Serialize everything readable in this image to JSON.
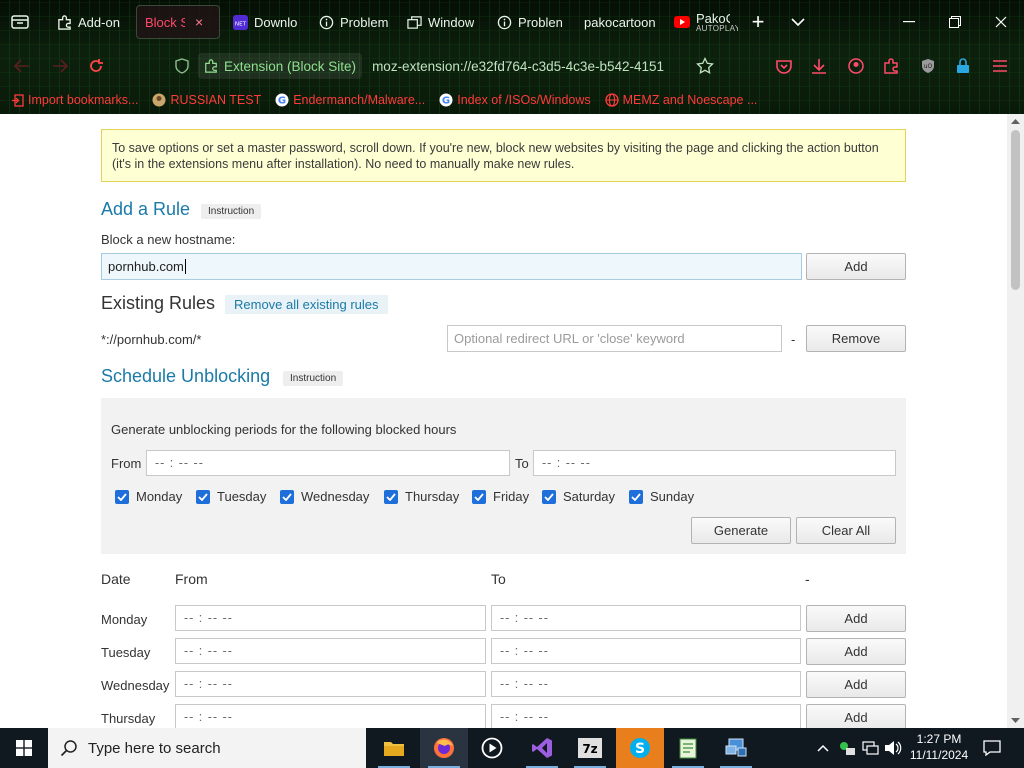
{
  "browser": {
    "tabs": [
      {
        "title": "Add-on",
        "icon": "puzzle-icon"
      },
      {
        "title": "Block S",
        "icon": "block-site-icon",
        "close": "×"
      },
      {
        "title": "Downlo",
        "icon": "dotnet-icon"
      },
      {
        "title": "Problem",
        "icon": "info-icon"
      },
      {
        "title": "Window",
        "icon": "windows-copy-icon"
      },
      {
        "title": "Problen",
        "icon": "info-icon"
      },
      {
        "title": "pakocartoon",
        "icon": ""
      },
      {
        "title": "PakoCa",
        "subtitle": "AUTOPLAY",
        "icon": "youtube-icon"
      }
    ],
    "new_tab": "+",
    "extension_chip": "Extension (Block Site)",
    "url": "moz-extension://e32fd764-c3d5-4c3e-b542-4151",
    "bookmarks": [
      {
        "label": "Import bookmarks...",
        "icon": "import-icon"
      },
      {
        "label": "RUSSIAN TEST",
        "icon": "avatar-icon"
      },
      {
        "label": "Endermanch/Malware...",
        "icon": "google-icon"
      },
      {
        "label": "Index of /ISOs/Windows",
        "icon": "google-icon"
      },
      {
        "label": "MEMZ and Noescape ...",
        "icon": "globe-icon"
      }
    ]
  },
  "page": {
    "notice": "To save options or set a master password, scroll down. If you're new, block new websites by visiting the page and clicking the action button (it's in the extensions menu after installation). No need to manually make new rules.",
    "add_rule": {
      "heading": "Add a Rule",
      "instruction": "Instruction",
      "label": "Block a new hostname:",
      "value": "pornhub.com",
      "button": "Add"
    },
    "existing_rules": {
      "heading": "Existing Rules",
      "remove_all": "Remove all existing rules",
      "rules": [
        {
          "pattern": "*://pornhub.com/*",
          "redirect_placeholder": "Optional redirect URL or 'close' keyword",
          "separator": "-",
          "button": "Remove"
        }
      ]
    },
    "schedule": {
      "heading": "Schedule Unblocking",
      "instruction": "Instruction",
      "generate_label": "Generate unblocking periods for the following blocked hours",
      "from_label": "From",
      "to_label": "To",
      "time_placeholder": "-- : --   --",
      "days": [
        "Monday",
        "Tuesday",
        "Wednesday",
        "Thursday",
        "Friday",
        "Saturday",
        "Sunday"
      ],
      "generate_button": "Generate",
      "clear_button": "Clear All",
      "table_headers": {
        "date": "Date",
        "from": "From",
        "to": "To",
        "dash": "-"
      },
      "rows": [
        {
          "day": "Monday",
          "button": "Add"
        },
        {
          "day": "Tuesday",
          "button": "Add"
        },
        {
          "day": "Wednesday",
          "button": "Add"
        },
        {
          "day": "Thursday",
          "button": "Add"
        }
      ]
    }
  },
  "taskbar": {
    "search_placeholder": "Type here to search",
    "time": "1:27 PM",
    "date": "11/11/2024",
    "apps": [
      "file-explorer-icon",
      "firefox-icon",
      "media-player-icon",
      "visual-studio-icon",
      "7zip-icon",
      "skype-icon",
      "notepad-icon",
      "network-share-icon"
    ]
  },
  "colors": {
    "heading": "#1a7aa8",
    "notice_bg": "#ffffd4",
    "bookmark": "#ff3b3b",
    "checkbox": "#1e6fd9"
  }
}
